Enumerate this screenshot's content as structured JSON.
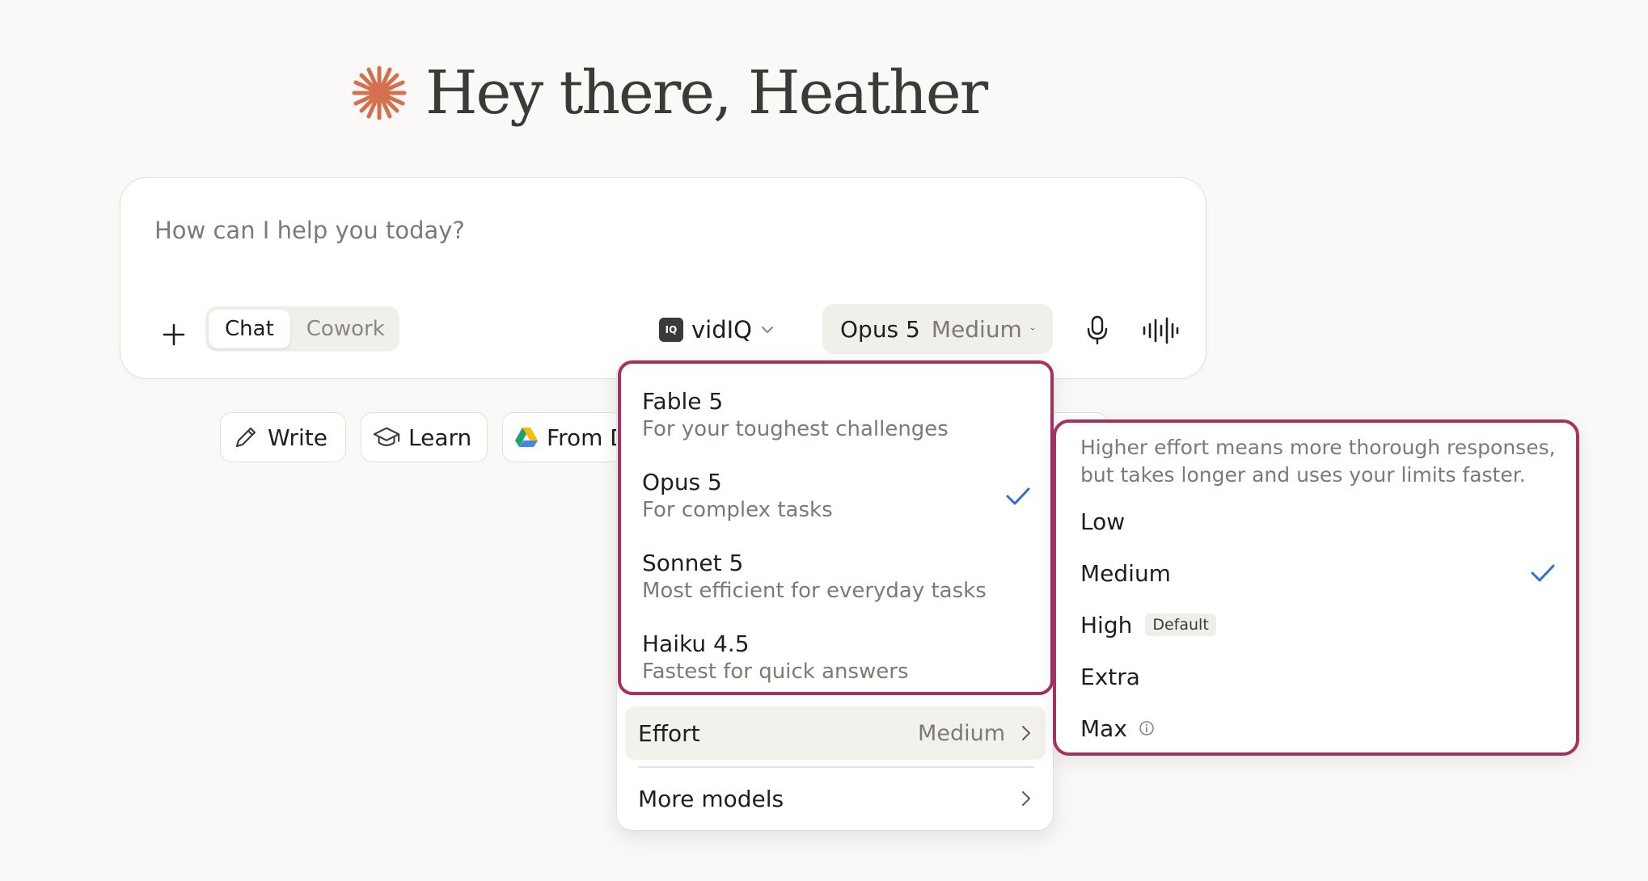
{
  "greeting": {
    "text": "Hey there, Heather"
  },
  "composer": {
    "placeholder": "How can I help you today?",
    "modes": [
      "Chat",
      "Cowork"
    ],
    "active_mode": "Chat",
    "integration_label": "vidIQ",
    "integration_logo_text": "IQ",
    "model_label": "Opus 5",
    "effort_label": "Medium"
  },
  "chips": [
    {
      "label": "Write"
    },
    {
      "label": "Learn"
    },
    {
      "label": "From D"
    }
  ],
  "model_menu": {
    "items": [
      {
        "name": "Fable 5",
        "desc": "For your toughest challenges",
        "selected": false
      },
      {
        "name": "Opus 5",
        "desc": "For complex tasks",
        "selected": true
      },
      {
        "name": "Sonnet 5",
        "desc": "Most efficient for everyday tasks",
        "selected": false
      },
      {
        "name": "Haiku 4.5",
        "desc": "Fastest for quick answers",
        "selected": false
      }
    ],
    "effort_label": "Effort",
    "effort_value": "Medium",
    "more_models_label": "More models"
  },
  "effort_menu": {
    "description": "Higher effort means more thorough responses, but takes longer and uses your limits faster.",
    "options": [
      {
        "label": "Low"
      },
      {
        "label": "Medium",
        "selected": true
      },
      {
        "label": "High",
        "badge": "Default"
      },
      {
        "label": "Extra"
      },
      {
        "label": "Max",
        "info": true
      }
    ]
  },
  "colors": {
    "accent_spark": "#d4704e",
    "highlight_border": "#a6305e",
    "check": "#2f6fd0"
  }
}
